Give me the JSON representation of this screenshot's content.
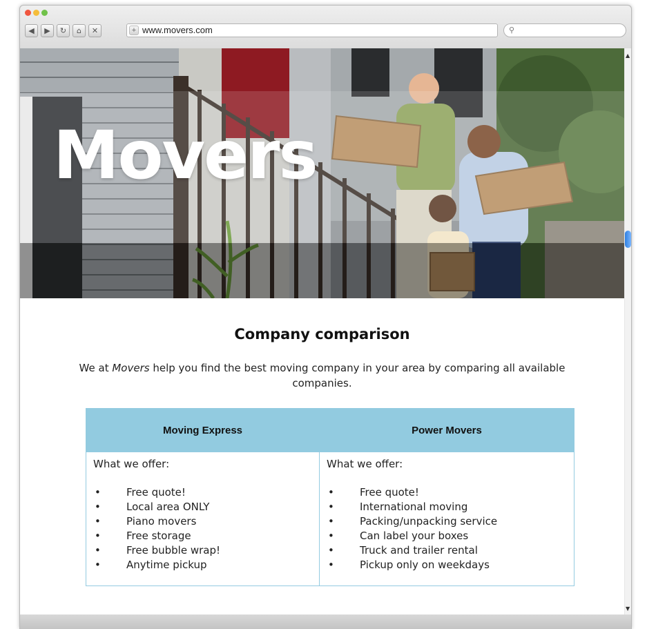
{
  "browser": {
    "url": "www.movers.com",
    "nav_icons": [
      "back-arrow-icon",
      "forward-arrow-icon",
      "reload-icon",
      "home-icon",
      "stop-icon"
    ],
    "search_icon": "search-icon"
  },
  "hero": {
    "title": "Movers"
  },
  "main": {
    "heading": "Company comparison",
    "intro_before": "We at ",
    "intro_brand": "Movers",
    "intro_after": " help you find the best moving company in your area by comparing all available companies."
  },
  "comparison": {
    "header_color": "#92cbe0",
    "columns": [
      {
        "name": "Moving Express",
        "label": "What we offer:",
        "items": [
          "Free quote!",
          "Local area ONLY",
          "Piano movers",
          "Free storage",
          "Free bubble wrap!",
          "Anytime pickup"
        ]
      },
      {
        "name": "Power Movers",
        "label": "What we offer:",
        "items": [
          "Free quote!",
          "International moving",
          "Packing/unpacking service",
          "Can label your boxes",
          "Truck and trailer rental",
          "Pickup only on weekdays"
        ]
      }
    ]
  }
}
